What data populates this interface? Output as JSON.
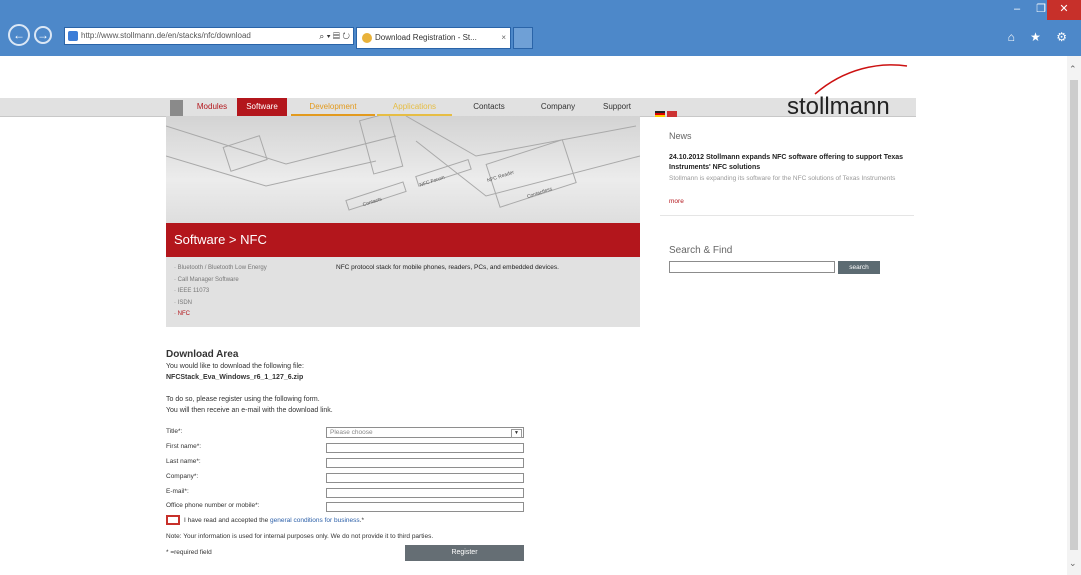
{
  "browser": {
    "address": "http://www.stollmann.de/en/stacks/nfc/download",
    "tab_title": "Download Registration - St...",
    "tab_close": "×",
    "back": "←",
    "forward": "→",
    "minimize": "–",
    "maximize": "❐",
    "close": "✕",
    "address_tools": "⌕ ▾ ▤ ↻",
    "right_icons": "⌂ ★ ⚙",
    "scroll_up": "⌃",
    "scroll_down": "⌄"
  },
  "site": {
    "nav": [
      "Modules",
      "Software",
      "Development",
      "Applications",
      "Contacts",
      "Company",
      "Support"
    ],
    "logo_text": "stollmann",
    "hero_labels": [
      "Contacts",
      "NFC Forum",
      "NFC Reader",
      "Contactless"
    ],
    "section_title": "Software > NFC",
    "sub_items": [
      "Bluetooth / Bluetooth Low Energy",
      "Call Manager Software",
      "IEEE 11073",
      "ISDN",
      "NFC"
    ],
    "sub_description": "NFC protocol stack for mobile phones, readers, PCs, and embedded devices."
  },
  "news": {
    "heading": "News",
    "headline": "24.10.2012 Stollmann expands NFC software offering to support Texas Instruments' NFC solutions",
    "body": "Stollmann is expanding its software for the NFC solutions of Texas Instruments",
    "more": "more"
  },
  "search": {
    "heading": "Search & Find",
    "button": "search"
  },
  "download": {
    "heading": "Download Area",
    "line1": "You would like to download the following file:",
    "file": "NFCStack_Eva_Windows_r6_1_127_6.zip",
    "line2": "To do so, please register using the following form.",
    "line3": "You will then receive an e-mail with the download link.",
    "fields": {
      "title": "Title*:",
      "first": "First name*:",
      "last": "Last name*:",
      "company": "Company*:",
      "email": "E-mail*:",
      "phone": "Office phone number or mobile*:"
    },
    "title_placeholder": "Please choose",
    "checkbox_text": "I have read and accepted the ",
    "terms_link": "general conditions for business",
    "checkbox_suffix": ".*",
    "note": "Note: Your information is used for internal purposes only. We do not provide it to third parties.",
    "required": "* =required field",
    "register": "Register"
  },
  "colors": {
    "brand_red": "#b3161c",
    "chrome_blue": "#4d88c9"
  }
}
